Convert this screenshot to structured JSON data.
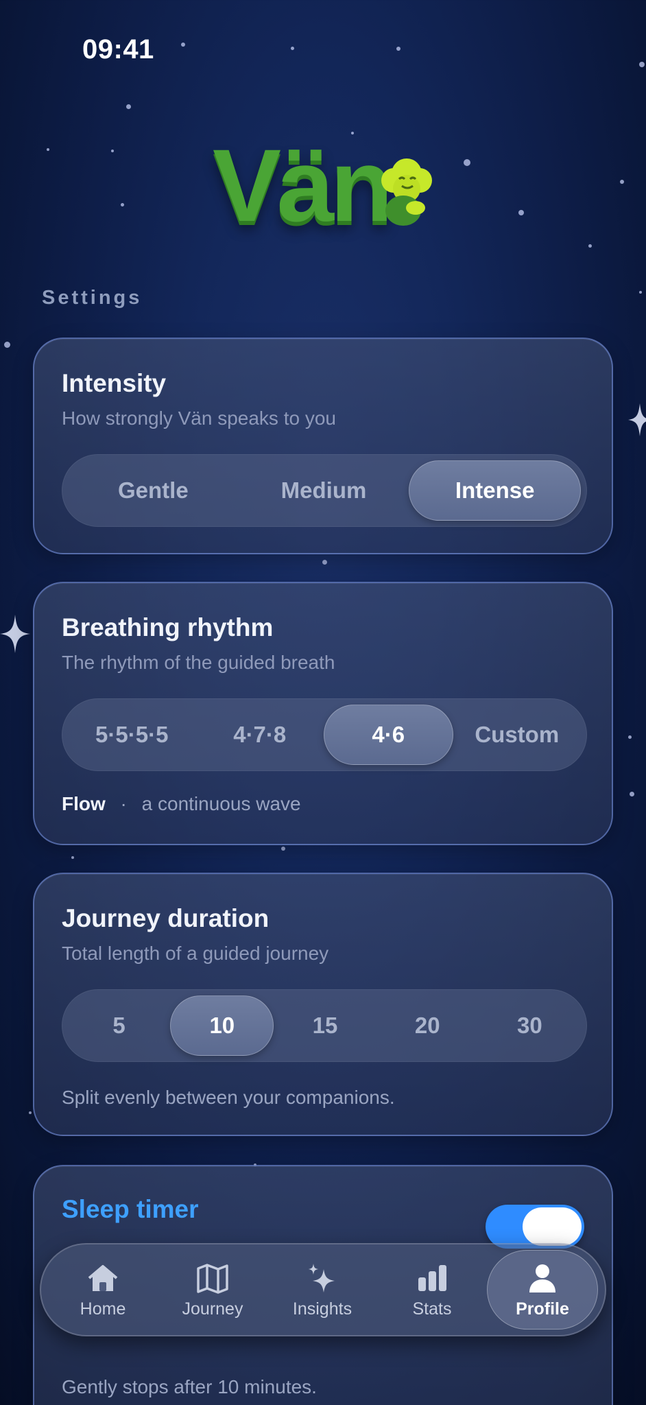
{
  "status_bar": {
    "time": "09:41"
  },
  "brand": {
    "logo_text": "Vän"
  },
  "settings": {
    "section_label": "Settings",
    "intensity": {
      "title": "Intensity",
      "subtitle": "How strongly Vän speaks to you",
      "options": [
        "Gentle",
        "Medium",
        "Intense"
      ],
      "selected": "Intense"
    },
    "breathing": {
      "title": "Breathing rhythm",
      "subtitle": "The rhythm of the guided breath",
      "options": [
        "5·5·5·5",
        "4·7·8",
        "4·6",
        "Custom"
      ],
      "selected": "4·6",
      "note_label": "Flow",
      "note_separator": "·",
      "note_text": "a continuous wave"
    },
    "journey": {
      "title": "Journey duration",
      "subtitle": "Total length of a guided journey",
      "options": [
        "5",
        "10",
        "15",
        "20",
        "30"
      ],
      "selected": "10",
      "note": "Split evenly between your companions."
    },
    "sleep": {
      "title": "Sleep timer",
      "enabled": true,
      "note": "Gently stops after 10 minutes."
    }
  },
  "tabbar": {
    "tabs": [
      {
        "label": "Home",
        "icon": "house-icon"
      },
      {
        "label": "Journey",
        "icon": "map-icon"
      },
      {
        "label": "Insights",
        "icon": "sparkles-icon"
      },
      {
        "label": "Stats",
        "icon": "bar-chart-icon"
      },
      {
        "label": "Profile",
        "icon": "person-icon"
      }
    ],
    "active": "Profile"
  },
  "colors": {
    "accent": "#2f8cff",
    "sleep_title": "#3ea0ff",
    "logo_green": "#4aa535"
  }
}
